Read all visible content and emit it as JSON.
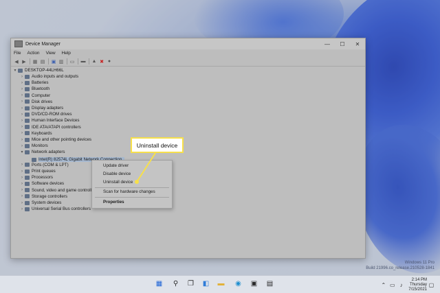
{
  "window": {
    "title": "Device Manager",
    "controls": {
      "minimize": "—",
      "maximize": "☐",
      "close": "✕"
    },
    "menu": [
      "File",
      "Action",
      "View",
      "Help"
    ]
  },
  "tree": {
    "root": "DESKTOP-44LH66L",
    "categories": [
      "Audio inputs and outputs",
      "Batteries",
      "Bluetooth",
      "Computer",
      "Disk drives",
      "Display adapters",
      "DVD/CD-ROM drives",
      "Human Interface Devices",
      "IDE ATA/ATAPI controllers",
      "Keyboards",
      "Mice and other pointing devices",
      "Monitors",
      "Network adapters",
      "Ports (COM & LPT)",
      "Print queues",
      "Processors",
      "Software devices",
      "Sound, video and game controllers",
      "Storage controllers",
      "System devices",
      "Universal Serial Bus controllers"
    ],
    "selected_device": "Intel(R) 82574L Gigabit Network Connection"
  },
  "context_menu": {
    "items": [
      "Update driver",
      "Disable device",
      "Uninstall device",
      "Scan for hardware changes",
      "Properties"
    ]
  },
  "callout": {
    "text": "Uninstall device",
    "color": "#f7e04a"
  },
  "watermark": {
    "line1": "Windows 11 Pro",
    "line2": "Build 21996.co_release.210528-1841"
  },
  "taskbar": {
    "icons": [
      "windows-start-icon",
      "search-icon",
      "task-view-icon",
      "widgets-icon",
      "file-explorer-icon",
      "edge-icon",
      "store-icon",
      "device-manager-icon"
    ],
    "time": "2:14 PM",
    "day": "Thursday",
    "date": "7/15/2021"
  }
}
